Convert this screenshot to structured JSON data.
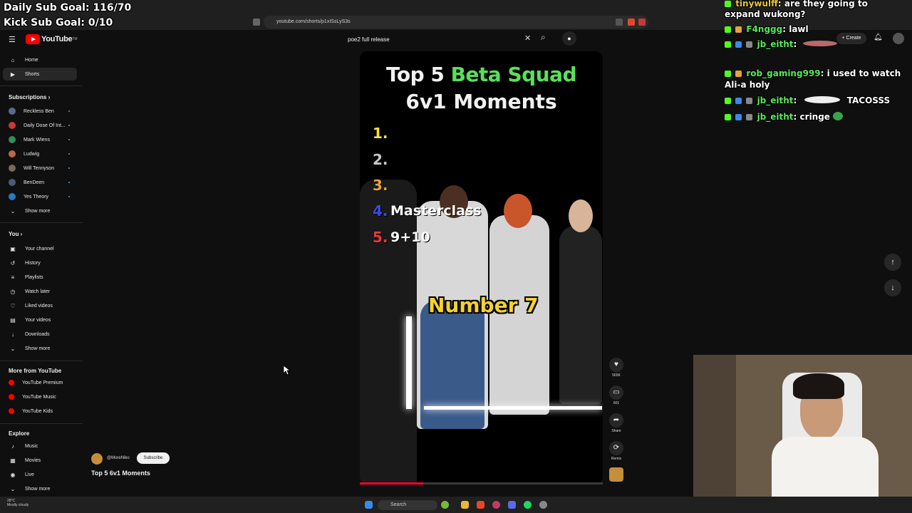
{
  "overlay": {
    "daily_sub_goal": "Daily Sub Goal: 116/70",
    "kick_sub_goal": "Kick Sub Goal: 0/10"
  },
  "browser": {
    "url": "youtube.com/shorts/p1xISsLyS3s"
  },
  "youtube": {
    "logo_text": "YouTube",
    "search_value": "poe2 full release"
  },
  "sidebar": {
    "home": "Home",
    "shorts": "Shorts",
    "subscriptions_title": "Subscriptions",
    "subscriptions": [
      {
        "label": "Reckless Ben",
        "color": "#5a6a8a"
      },
      {
        "label": "Daily Dose Of Int...",
        "color": "#c23a3a"
      },
      {
        "label": "Mark Wiens",
        "color": "#3a8a5a"
      },
      {
        "label": "Ludwig",
        "color": "#b86a4a"
      },
      {
        "label": "Will Tennyson",
        "color": "#7a6a5a"
      },
      {
        "label": "BenDeen",
        "color": "#4a5a7a"
      },
      {
        "label": "Yes Theory",
        "color": "#2a7ac2"
      }
    ],
    "show_more": "Show more",
    "you_title": "You",
    "you_items": [
      "Your channel",
      "History",
      "Playlists",
      "Watch later",
      "Liked videos",
      "Your videos",
      "Downloads"
    ],
    "more_title": "More from YouTube",
    "more_items": [
      "YouTube Premium",
      "YouTube Music",
      "YouTube Kids"
    ],
    "explore_title": "Explore",
    "explore_items": [
      "Music",
      "Movies",
      "Live"
    ]
  },
  "short": {
    "title_top": "Top 5",
    "title_highlight": "Beta Squad",
    "title_bottom": "6v1 Moments",
    "ranks": [
      {
        "num": "1.",
        "label": "",
        "color": "#f7e23a"
      },
      {
        "num": "2.",
        "label": "",
        "color": "#c8c8c8"
      },
      {
        "num": "3.",
        "label": "",
        "color": "#e8a23a"
      },
      {
        "num": "4.",
        "label": "Masterclass",
        "color": "#3a4ae8"
      },
      {
        "num": "5.",
        "label": "9+10",
        "color": "#e83a3a"
      }
    ],
    "caption": "Number 7",
    "likes": "565K",
    "comments": "601",
    "share": "Share",
    "remix": "Remix",
    "progress_fraction": 0.26
  },
  "channel": {
    "handle": "@MoreNiko",
    "subscribe": "Subscribe",
    "video_title": "Top 5 6v1 Moments"
  },
  "chat": [
    {
      "user": "tinywulff",
      "msg": "are they going to",
      "color": "#e8c83a"
    },
    {
      "user": "",
      "msg": "expand wukong?",
      "color": "#ffffff"
    },
    {
      "user": "F4nggg",
      "msg": "lawl",
      "color": "#5ae85a"
    },
    {
      "user": "jb_eitht",
      "msg": "",
      "color": "#5ae85a"
    },
    {
      "user": "rob_gaming999",
      "msg": "i used to watch",
      "color": "#5ae85a"
    },
    {
      "user": "",
      "msg": "Ali-a holy",
      "color": "#ffffff"
    },
    {
      "user": "jb_eitht",
      "msg": "TACOSSS",
      "color": "#5ae85a"
    },
    {
      "user": "jb_eitht",
      "msg": "cringe",
      "color": "#5ae85a"
    }
  ],
  "taskbar": {
    "search": "Search",
    "temp": "28°C",
    "weather": "Mostly cloudy"
  }
}
